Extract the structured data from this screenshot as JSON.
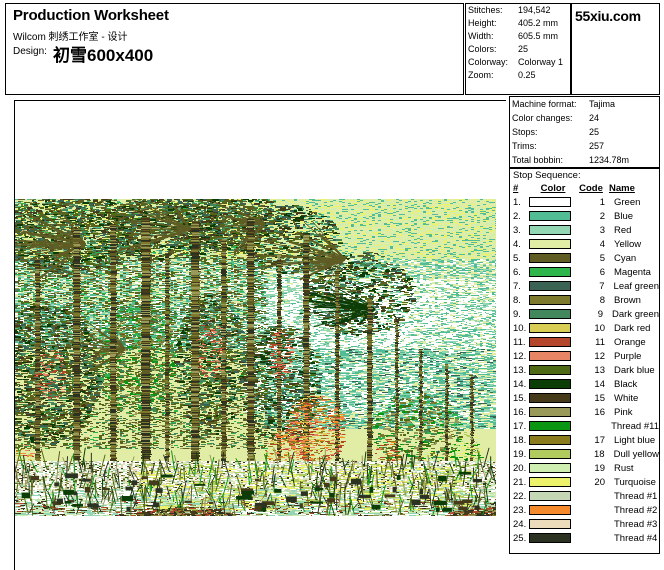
{
  "header": {
    "title": "Production Worksheet",
    "app_line": "Wilcom 刺绣工作室 - 设计",
    "design_label": "Design:",
    "design_name": "初雪600x400"
  },
  "brand": {
    "text": "55xiu.com"
  },
  "stats": {
    "rows": [
      {
        "label": "Stitches:",
        "value": "194,542"
      },
      {
        "label": "Height:",
        "value": "405.2 mm"
      },
      {
        "label": "Width:",
        "value": "605.5 mm"
      },
      {
        "label": "Colors:",
        "value": "25"
      },
      {
        "label": "Colorway:",
        "value": "Colorway 1"
      },
      {
        "label": "Zoom:",
        "value": "0.25"
      }
    ]
  },
  "machine": {
    "rows": [
      {
        "label": "Machine format:",
        "value": "Tajima"
      },
      {
        "label": "Color changes:",
        "value": "24"
      },
      {
        "label": "Stops:",
        "value": "25"
      },
      {
        "label": "Trims:",
        "value": "257"
      },
      {
        "label": "Total bobbin:",
        "value": "1234.78m"
      }
    ]
  },
  "stop_sequence": {
    "title": "Stop Sequence:",
    "headers": {
      "num": "#",
      "color": "Color",
      "code": "Code",
      "name": "Name"
    },
    "rows": [
      {
        "num": "1.",
        "color": "#ffffff",
        "code": "1",
        "name": "Green"
      },
      {
        "num": "2.",
        "color": "#52bd94",
        "code": "2",
        "name": "Blue"
      },
      {
        "num": "3.",
        "color": "#93d6b4",
        "code": "3",
        "name": "Red"
      },
      {
        "num": "4.",
        "color": "#e1eda4",
        "code": "4",
        "name": "Yellow"
      },
      {
        "num": "5.",
        "color": "#5f5c24",
        "code": "5",
        "name": "Cyan"
      },
      {
        "num": "6.",
        "color": "#2eb54b",
        "code": "6",
        "name": "Magenta"
      },
      {
        "num": "7.",
        "color": "#3b6354",
        "code": "7",
        "name": "Leaf green"
      },
      {
        "num": "8.",
        "color": "#7d7a2e",
        "code": "8",
        "name": "Brown"
      },
      {
        "num": "9.",
        "color": "#43875c",
        "code": "9",
        "name": "Dark green"
      },
      {
        "num": "10.",
        "color": "#d8cd55",
        "code": "10",
        "name": "Dark red"
      },
      {
        "num": "11.",
        "color": "#b4472b",
        "code": "11",
        "name": "Orange"
      },
      {
        "num": "12.",
        "color": "#e78564",
        "code": "12",
        "name": "Purple"
      },
      {
        "num": "13.",
        "color": "#4e6a15",
        "code": "13",
        "name": "Dark blue"
      },
      {
        "num": "14.",
        "color": "#0d3d07",
        "code": "14",
        "name": "Black"
      },
      {
        "num": "15.",
        "color": "#453b1b",
        "code": "15",
        "name": "White"
      },
      {
        "num": "16.",
        "color": "#99995a",
        "code": "16",
        "name": "Pink"
      },
      {
        "num": "17.",
        "color": "#0a9612",
        "code": "",
        "name": "Thread #11"
      },
      {
        "num": "18.",
        "color": "#8a7b1c",
        "code": "17",
        "name": "Light blue"
      },
      {
        "num": "19.",
        "color": "#b1cb5f",
        "code": "18",
        "name": "Dull yellow"
      },
      {
        "num": "20.",
        "color": "#cfeeb2",
        "code": "19",
        "name": "Rust"
      },
      {
        "num": "21.",
        "color": "#ecf26a",
        "code": "20",
        "name": "Turquoise"
      },
      {
        "num": "22.",
        "color": "#c5d8b5",
        "code": "",
        "name": "Thread #1"
      },
      {
        "num": "23.",
        "color": "#f58a2d",
        "code": "",
        "name": "Thread #2"
      },
      {
        "num": "24.",
        "color": "#ecdcbb",
        "code": "",
        "name": "Thread #3"
      },
      {
        "num": "25.",
        "color": "#2c3221",
        "code": "",
        "name": "Thread #4"
      }
    ]
  },
  "design_preview": {
    "alt": "Embroidered forest landscape with conifer trees, snow-covered ground and a stream"
  }
}
